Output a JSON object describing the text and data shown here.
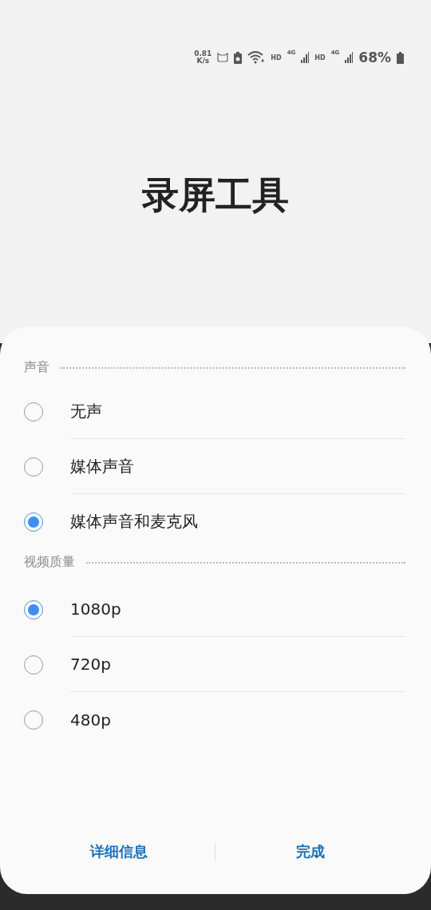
{
  "status_bar": {
    "speed": [
      "0.81",
      "K/s"
    ],
    "network": [
      {
        "hd": "HD",
        "gen": "4G"
      },
      {
        "hd": "HD",
        "gen": "4G"
      }
    ],
    "battery": "68%"
  },
  "title": "录屏工具",
  "sections": [
    {
      "heading": "声音",
      "options": [
        {
          "label": "无声",
          "selected": false
        },
        {
          "label": "媒体声音",
          "selected": false
        },
        {
          "label": "媒体声音和麦克风",
          "selected": true
        }
      ]
    },
    {
      "heading": "视频质量",
      "options": [
        {
          "label": "1080p",
          "selected": true
        },
        {
          "label": "720p",
          "selected": false
        },
        {
          "label": "480p",
          "selected": false
        }
      ]
    }
  ],
  "buttons": [
    "详细信息",
    "完成"
  ]
}
